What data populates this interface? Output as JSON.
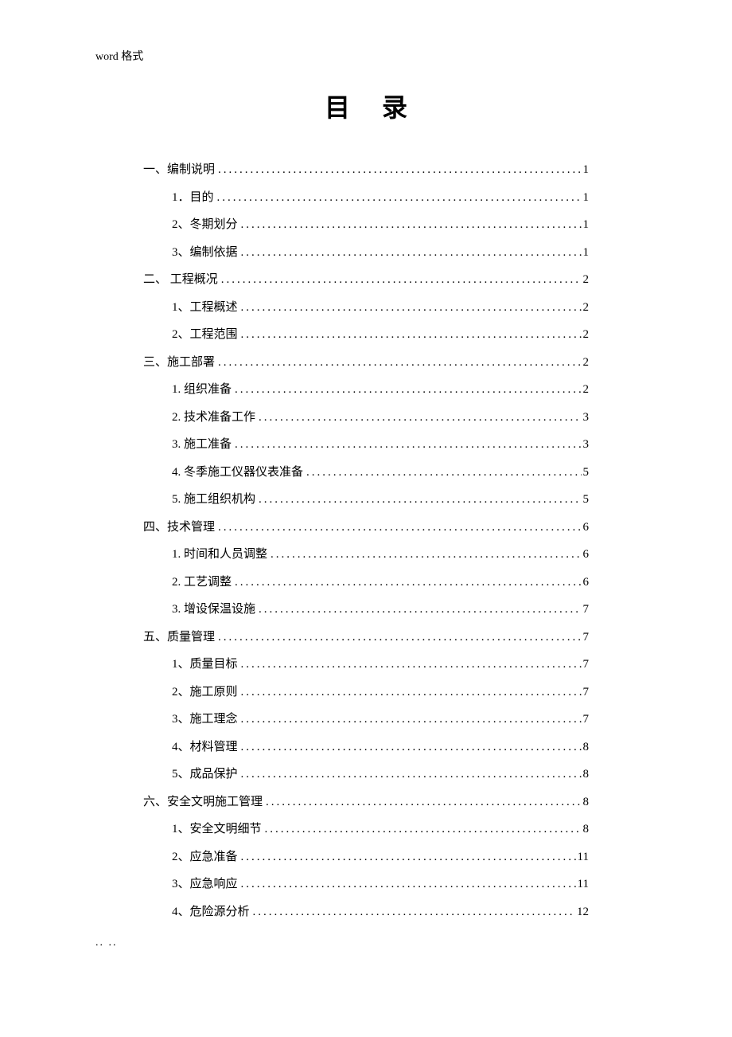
{
  "header": "word 格式",
  "title": "目录",
  "footer": "..   ..",
  "toc": [
    {
      "level": 1,
      "label": "一、编制说明",
      "page": "1"
    },
    {
      "level": 2,
      "label": "1．目的",
      "page": "1"
    },
    {
      "level": 2,
      "label": "2、冬期划分",
      "page": "1"
    },
    {
      "level": 2,
      "label": "3、编制依据",
      "page": "1"
    },
    {
      "level": 1,
      "label": "二、 工程概况",
      "page": "2"
    },
    {
      "level": 2,
      "label": "1、工程概述",
      "page": "2"
    },
    {
      "level": 2,
      "label": "2、工程范围",
      "page": "2"
    },
    {
      "level": 1,
      "label": "三、施工部署",
      "page": "2"
    },
    {
      "level": 2,
      "label": "1. 组织准备",
      "page": "2"
    },
    {
      "level": 2,
      "label": "2. 技术准备工作",
      "page": "3"
    },
    {
      "level": 2,
      "label": "3. 施工准备",
      "page": "3"
    },
    {
      "level": 2,
      "label": "4. 冬季施工仪器仪表准备",
      "page": "5"
    },
    {
      "level": 2,
      "label": "5. 施工组织机构",
      "page": "5"
    },
    {
      "level": 1,
      "label": "四、技术管理",
      "page": "6"
    },
    {
      "level": 2,
      "label": "1. 时间和人员调整",
      "page": "6"
    },
    {
      "level": 2,
      "label": "2. 工艺调整",
      "page": "6"
    },
    {
      "level": 2,
      "label": "3. 增设保温设施",
      "page": "7"
    },
    {
      "level": 1,
      "label": "五、质量管理",
      "page": "7"
    },
    {
      "level": 2,
      "label": "1、质量目标",
      "page": "7"
    },
    {
      "level": 2,
      "label": "2、施工原则",
      "page": "7"
    },
    {
      "level": 2,
      "label": "3、施工理念",
      "page": "7"
    },
    {
      "level": 2,
      "label": "4、材料管理",
      "page": "8"
    },
    {
      "level": 2,
      "label": "5、成品保护",
      "page": "8"
    },
    {
      "level": 1,
      "label": "六、安全文明施工管理",
      "page": "8"
    },
    {
      "level": 2,
      "label": "1、安全文明细节",
      "page": "8"
    },
    {
      "level": 2,
      "label": "2、应急准备",
      "page": "11"
    },
    {
      "level": 2,
      "label": "3、应急响应",
      "page": "11"
    },
    {
      "level": 2,
      "label": "4、危险源分析",
      "page": "12"
    }
  ]
}
